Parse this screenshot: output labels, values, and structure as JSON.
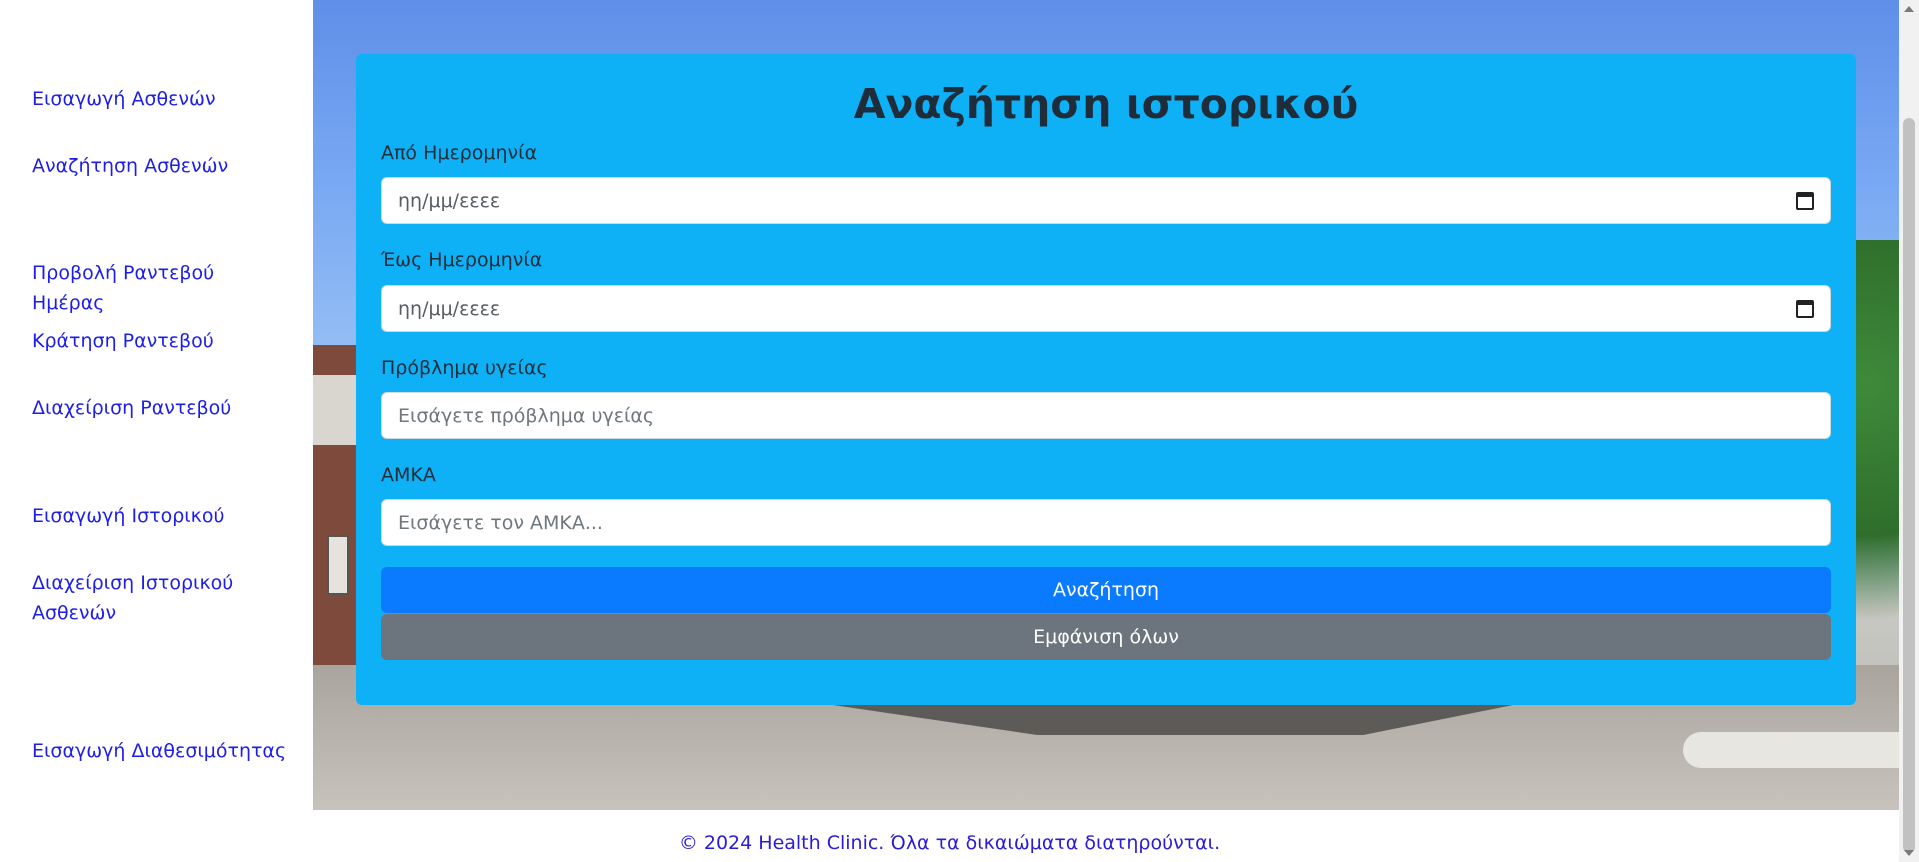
{
  "sidebar": {
    "items": [
      {
        "label": "Εισαγωγή Ασθενών"
      },
      {
        "label": "Αναζήτηση Ασθενών"
      },
      {
        "label": "Προβολή Ραντεβού Ημέρας"
      },
      {
        "label": "Κράτηση Ραντεβού"
      },
      {
        "label": "Διαχείριση Ραντεβού"
      },
      {
        "label": "Εισαγωγή Ιστορικού"
      },
      {
        "label": "Διαχείριση Ιστορικού Ασθενών"
      },
      {
        "label": "Εισαγωγή Διαθεσιμότητας"
      }
    ]
  },
  "form": {
    "title": "Αναζήτηση ιστορικού",
    "from_date": {
      "label": "Από Ημερομηνία",
      "placeholder": "ηη/μμ/εεεε"
    },
    "to_date": {
      "label": "Έως Ημερομηνία",
      "placeholder": "ηη/μμ/εεεε"
    },
    "health_problem": {
      "label": "Πρόβλημα υγείας",
      "placeholder": "Εισάγετε πρόβλημα υγείας"
    },
    "amka": {
      "label": "ΑΜΚΑ",
      "placeholder": "Εισάγετε τον ΑΜΚΑ..."
    },
    "search_button": "Αναζήτηση",
    "show_all_button": "Εμφάνιση όλων"
  },
  "footer": {
    "text": "© 2024 Health Clinic. Όλα τα δικαιώματα διατηρούνται."
  },
  "colors": {
    "card": "#0eb0f6",
    "primary": "#0a7bff",
    "secondary": "#6c757d",
    "link": "#1e1ee6"
  }
}
